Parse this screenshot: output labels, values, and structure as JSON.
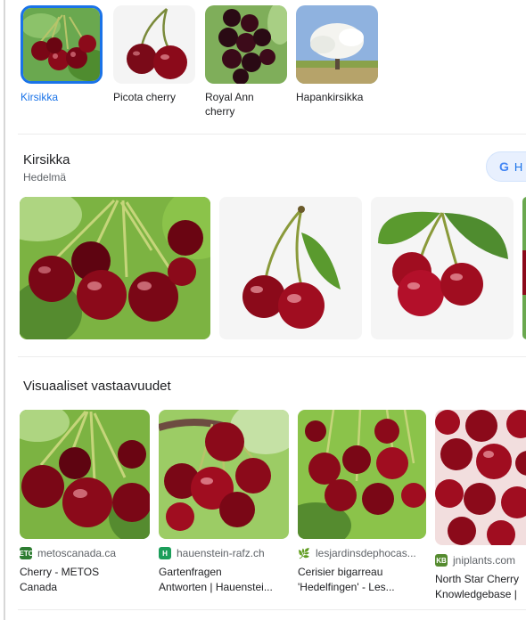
{
  "chips": [
    {
      "label": "Kirsikka",
      "selected": true
    },
    {
      "label": "Picota cherry",
      "selected": false
    },
    {
      "label": "Royal Ann cherry",
      "selected": false
    },
    {
      "label": "Hapankirsikka",
      "selected": false
    }
  ],
  "knowledge": {
    "title": "Kirsikka",
    "subtitle": "Hedelmä",
    "google_button": {
      "icon": "google-g-icon",
      "label": "H"
    }
  },
  "gallery": {
    "images": [
      "cherry-cluster-leaves",
      "cherry-pair-leaf",
      "cherry-pair-two-leaves",
      "cherry-partial"
    ]
  },
  "visual_matches": {
    "title": "Visuaaliset vastaavuudet",
    "items": [
      {
        "source": "metoscanada.ca",
        "favicon_text": "METOS",
        "favicon_color": "#2e7d32",
        "title_lines": [
          "Cherry - METOS",
          "Canada"
        ]
      },
      {
        "source": "hauenstein-rafz.ch",
        "favicon_text": "H",
        "favicon_color": "#1b9e5a",
        "title_lines": [
          "Gartenfragen",
          "Antworten | Hauenstei..."
        ]
      },
      {
        "source": "lesjardinsdephocas...",
        "favicon_text": "",
        "favicon_color": "#8bc34a",
        "title_lines": [
          "Cerisier bigarreau",
          "'Hedelfingen' - Les..."
        ]
      },
      {
        "source": "jniplants.com",
        "favicon_text": "KB",
        "favicon_color": "#558b2f",
        "title_lines": [
          "North Star Cherry",
          "Knowledgebase |"
        ]
      }
    ]
  },
  "colors": {
    "accent": "#1a73e8",
    "cherry": "#8b0a1a",
    "leaf": "#5a9a2e"
  }
}
